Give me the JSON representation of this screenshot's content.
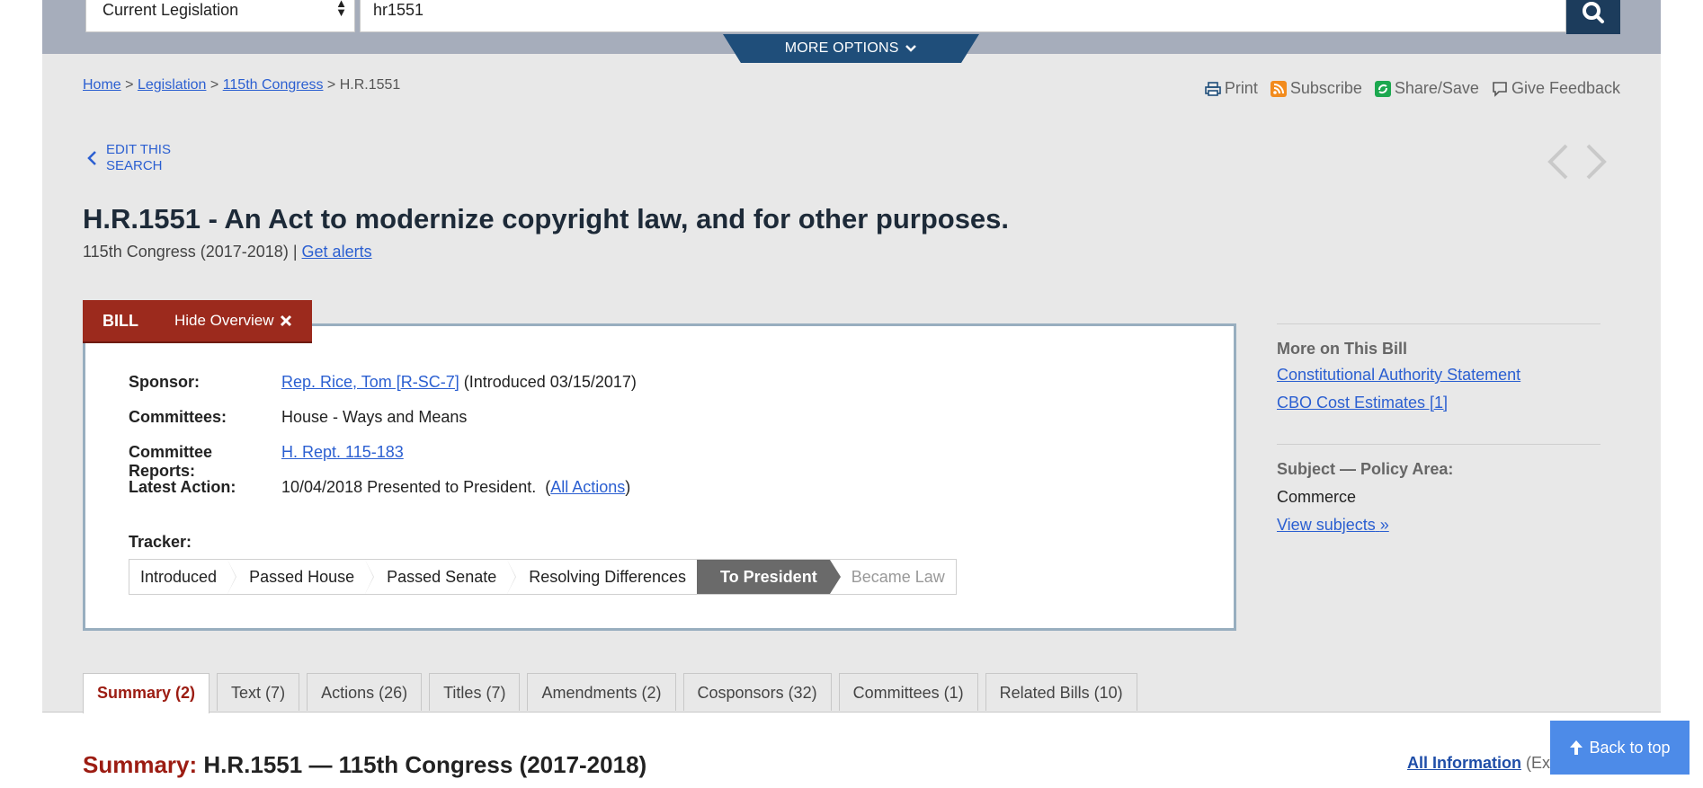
{
  "search": {
    "collection_value": "Current Legislation",
    "query_value": "hr1551",
    "more_options_label": "MORE OPTIONS"
  },
  "breadcrumb": {
    "items": [
      "Home",
      "Legislation",
      "115th Congress"
    ],
    "current": "H.R.1551",
    "separator": ">"
  },
  "tools": {
    "print": "Print",
    "subscribe": "Subscribe",
    "share": "Share/Save",
    "feedback": "Give Feedback"
  },
  "edit_search": "EDIT THIS SEARCH",
  "bill": {
    "title": "H.R.1551 - An Act to modernize copyright law, and for other purposes.",
    "congress": "115th Congress (2017-2018)",
    "divider": "|",
    "alerts_link": "Get alerts",
    "tab_label": "BILL",
    "hide_overview": "Hide Overview"
  },
  "overview": {
    "sponsor_key": "Sponsor:",
    "sponsor_link": "Rep. Rice, Tom [R-SC-7]",
    "sponsor_note": "(Introduced 03/15/2017)",
    "committees_key": "Committees:",
    "committees_value": "House - Ways and Means",
    "reports_key": "Committee Reports:",
    "reports_link": "H. Rept. 115-183",
    "action_key": "Latest Action:",
    "action_value": "10/04/2018 Presented to President.",
    "action_link": "All Actions",
    "tracker_label": "Tracker:",
    "tracker_steps": [
      "Introduced",
      "Passed House",
      "Passed Senate",
      "Resolving Differences",
      "To President",
      "Became Law"
    ]
  },
  "sidebar": {
    "more_head": "More on This Bill",
    "link1": "Constitutional Authority Statement",
    "link2": "CBO Cost Estimates [1]",
    "subject_head": "Subject — Policy Area:",
    "subject_value": "Commerce",
    "subject_link": "View subjects"
  },
  "tabs": [
    "Summary (2)",
    "Text (7)",
    "Actions (26)",
    "Titles (7)",
    "Amendments (2)",
    "Cosponsors (32)",
    "Committees (1)",
    "Related Bills (10)"
  ],
  "summary": {
    "label": "Summary:",
    "text": "H.R.1551 — 115th Congress (2017-2018)",
    "all_info_link": "All Information",
    "all_info_note": "(Except Text)"
  },
  "back_to_top": "Back to top",
  "colors": {
    "bill_red": "#9c2a1d",
    "navy": "#1f4e7a",
    "link_blue": "#2b5fd1",
    "back_top_blue": "#4d8be8"
  }
}
